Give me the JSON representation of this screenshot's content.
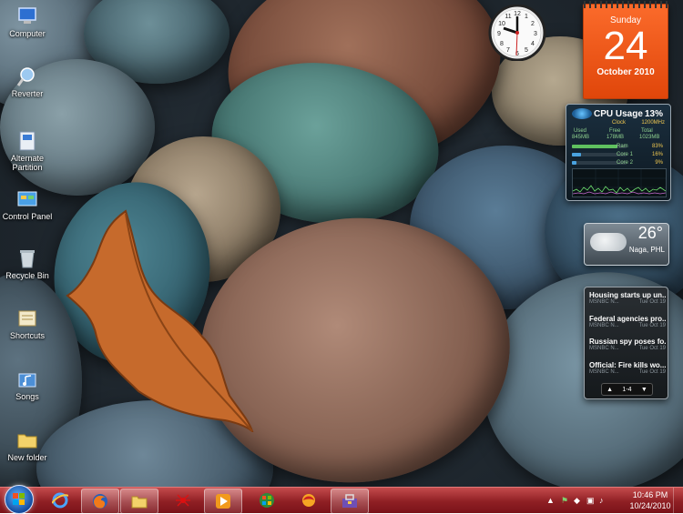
{
  "desktop": {
    "icons": [
      {
        "label": "Computer"
      },
      {
        "label": "Reverter"
      },
      {
        "label": "Alternate Partition"
      },
      {
        "label": "Control Panel"
      },
      {
        "label": "Recycle Bin"
      },
      {
        "label": "Shortcuts"
      },
      {
        "label": "Songs"
      },
      {
        "label": "New folder"
      }
    ]
  },
  "gadgets": {
    "clock": {
      "numerals": [
        "12",
        "1",
        "2",
        "3",
        "4",
        "5",
        "6",
        "7",
        "8",
        "9",
        "10",
        "11"
      ]
    },
    "calendar": {
      "weekday": "Sunday",
      "day": "24",
      "month_year": "October 2010"
    },
    "cpu": {
      "title": "CPU Usage",
      "percent": "13%",
      "clock_label": "Clock",
      "clock_value": "1200MHz",
      "used_label": "Used",
      "free_label": "Free",
      "total_label": "Total",
      "used_value": "845MB",
      "free_value": "178MB",
      "total_value": "1023MB",
      "ram_label": "Ram",
      "ram_value": "83%",
      "core1_label": "Core 1",
      "core1_value": "16%",
      "core2_label": "Core 2",
      "core2_value": "9%",
      "ram_fraction": 0.83,
      "core1_fraction": 0.16,
      "core2_fraction": 0.09
    },
    "weather": {
      "temperature": "26°",
      "location": "Naga, PHL"
    },
    "news": {
      "items": [
        {
          "headline": "Housing starts up un...",
          "source": "MSNBC N...",
          "date": "Tue Oct 19"
        },
        {
          "headline": "Federal agencies pro...",
          "source": "MSNBC N...",
          "date": "Tue Oct 19"
        },
        {
          "headline": "Russian spy poses fo...",
          "source": "MSNBC N...",
          "date": "Tue Oct 19"
        },
        {
          "headline": "Official: Fire kills wo...",
          "source": "MSNBC N...",
          "date": "Tue Oct 19"
        }
      ],
      "pager": "1-4"
    }
  },
  "taskbar": {
    "apps": [
      {
        "icon": "internet-explorer-icon"
      },
      {
        "icon": "firefox-icon"
      },
      {
        "icon": "explorer-folder-icon"
      },
      {
        "icon": "spider-icon"
      },
      {
        "icon": "media-player-icon"
      },
      {
        "icon": "windows-logo-icon"
      },
      {
        "icon": "browser-swirl-icon"
      },
      {
        "icon": "toolbox-icon"
      }
    ],
    "time": "10:46 PM",
    "date": "10/24/2010"
  },
  "colors": {
    "taskbar": "#8f1f24",
    "calendar": "#e0460a",
    "cpu_bar": "#5fc15f"
  }
}
